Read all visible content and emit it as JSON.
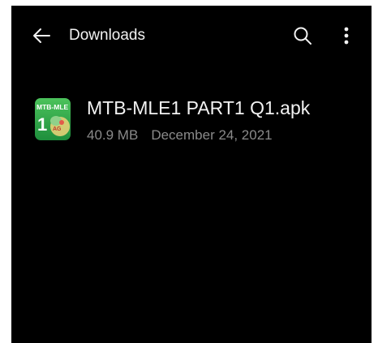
{
  "app_bar": {
    "title": "Downloads",
    "back_icon": "arrow-left-icon",
    "search_icon": "search-icon",
    "more_icon": "more-vertical-icon"
  },
  "files": [
    {
      "name": "MTB-MLE1 PART1 Q1.apk",
      "size": "40.9 MB",
      "date": "December 24, 2021",
      "icon": "apk-app-icon",
      "icon_text": [
        "MTB-MLE",
        "1"
      ]
    }
  ],
  "colors": {
    "background": "#000000",
    "text_primary": "#f2f2f2",
    "text_secondary": "#8a8a8a",
    "icon_green": "#2fa84a"
  }
}
